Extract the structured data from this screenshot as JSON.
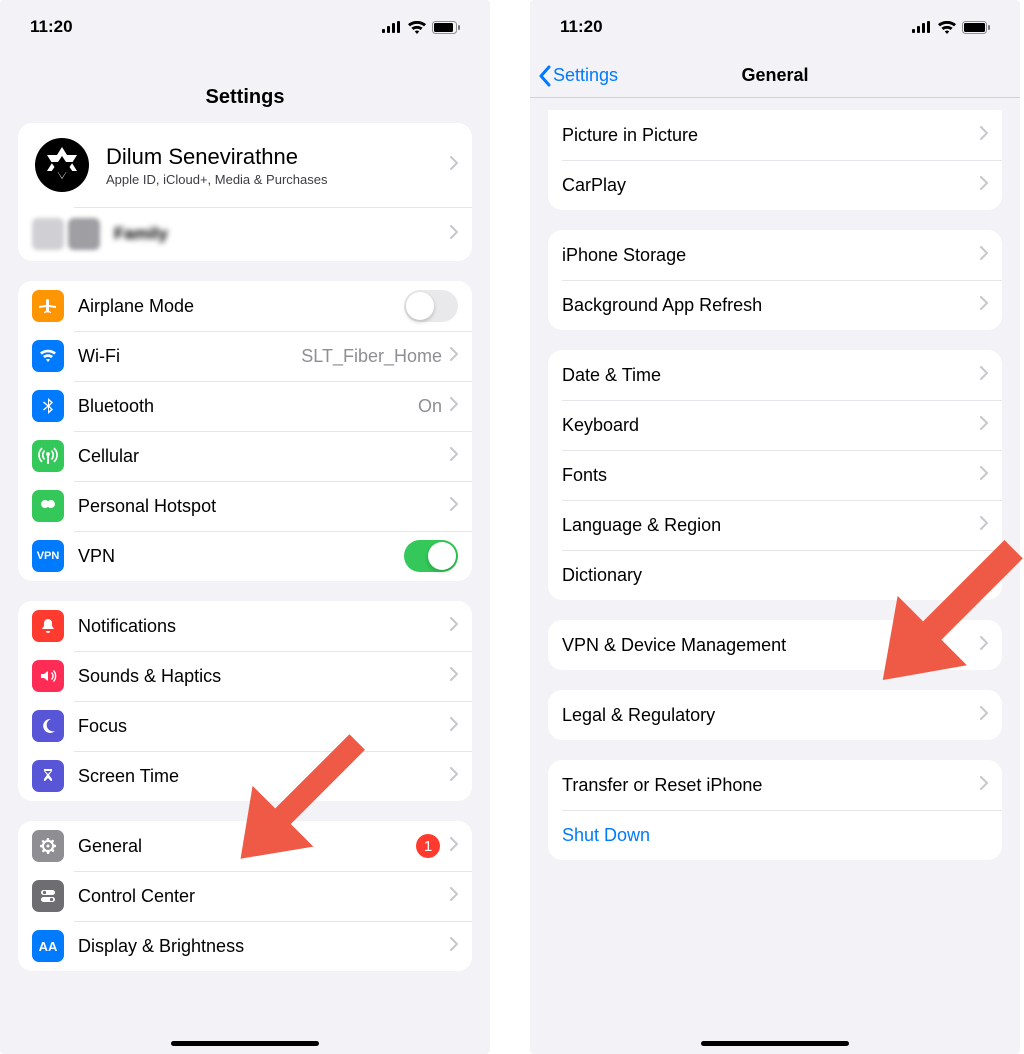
{
  "status": {
    "time": "11:20"
  },
  "left": {
    "title": "Settings",
    "profile": {
      "name": "Dilum Senevirathne",
      "subtitle": "Apple ID, iCloud+, Media & Purchases"
    },
    "family_label": "Family",
    "airplane": "Airplane Mode",
    "wifi": {
      "label": "Wi-Fi",
      "value": "SLT_Fiber_Home"
    },
    "bluetooth": {
      "label": "Bluetooth",
      "value": "On"
    },
    "cellular": "Cellular",
    "hotspot": "Personal Hotspot",
    "vpn": "VPN",
    "vpn_on": true,
    "notifications": "Notifications",
    "sounds": "Sounds & Haptics",
    "focus": "Focus",
    "screentime": "Screen Time",
    "general": {
      "label": "General",
      "badge": "1"
    },
    "controlcenter": "Control Center",
    "display": "Display & Brightness"
  },
  "right": {
    "back": "Settings",
    "title": "General",
    "pip": "Picture in Picture",
    "carplay": "CarPlay",
    "storage": "iPhone Storage",
    "refresh": "Background App Refresh",
    "datetime": "Date & Time",
    "keyboard": "Keyboard",
    "fonts": "Fonts",
    "language": "Language & Region",
    "dictionary": "Dictionary",
    "vpndm": "VPN & Device Management",
    "legal": "Legal & Regulatory",
    "transfer": "Transfer or Reset iPhone",
    "shutdown": "Shut Down"
  }
}
